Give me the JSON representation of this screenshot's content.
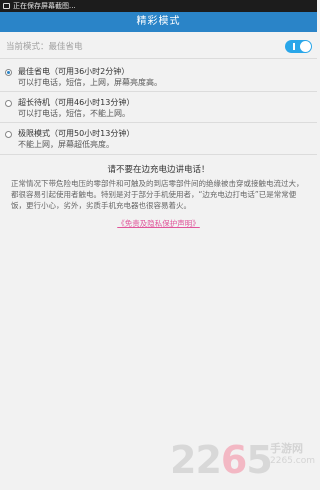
{
  "status_bar": {
    "notification_text": "正在保存屏幕截图..."
  },
  "header": {
    "title": "精彩模式"
  },
  "current_mode": {
    "label": "当前模式：最佳省电",
    "toggle_on": true,
    "toggle_color": "#29a6e9"
  },
  "modes": [
    {
      "title": "最佳省电（可用36小时2分钟）",
      "desc": "可以打电话，短信，上网，屏幕亮度高。",
      "selected": true
    },
    {
      "title": "超长待机（可用46小时13分钟）",
      "desc": "可以打电话，短信，不能上网。",
      "selected": false
    },
    {
      "title": "极限模式（可用50小时13分钟）",
      "desc": "不能上网，屏幕超低亮度。",
      "selected": false
    }
  ],
  "warning": {
    "title": "请不要在边充电边讲电话！",
    "body": "正常情况下带危险电压的零部件和可触及的到店零部件间的绝缘被击穿或接触电流过大，都很容易引起使用者触电。特别是对于部分手机使用者，“边充电边打电话”已是常常便饭，更行小心，劣外，劣质手机充电器也很容易着火。",
    "link": "《免责及隐私保护声明》"
  },
  "watermark": {
    "number_prefix": "22",
    "number_accent": "6",
    "number_suffix": "5",
    "site_name": "手游网",
    "url": "2265.com"
  },
  "colors": {
    "header_bg": "#2a84c8",
    "link": "#e0559a"
  }
}
